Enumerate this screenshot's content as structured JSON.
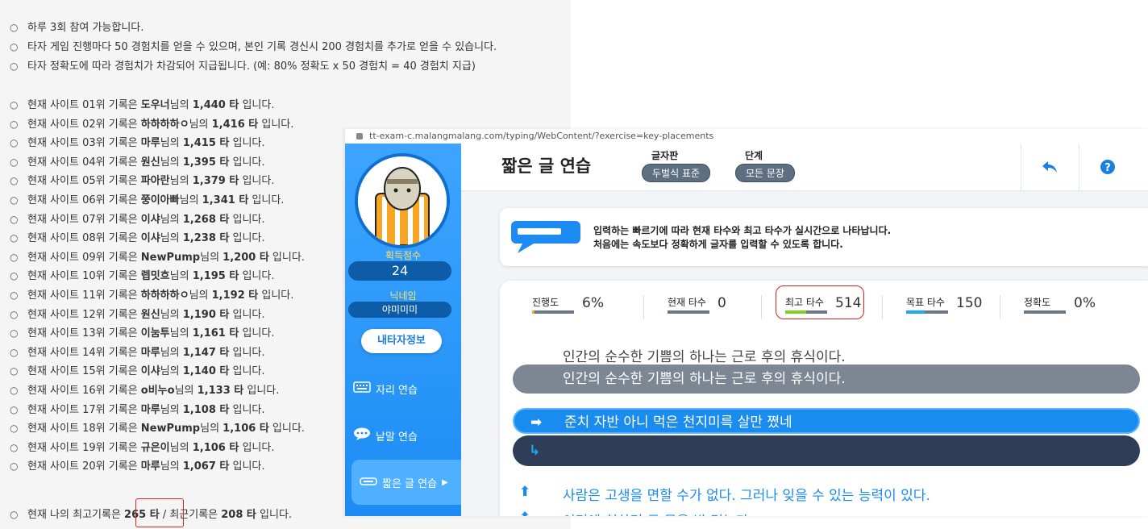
{
  "notices": {
    "rules": [
      "하루 3회 참여 가능합니다.",
      "타자 게임 진행마다 50 경험치를 얻을 수 있으며, 본인 기록 경신시 200 경험치를 추가로 얻을 수 있습니다.",
      "타자 정확도에 따라 경험치가 차감되어 지급됩니다. (예: 80% 정확도 x 50 경험치 = 40 경험치 지급)"
    ],
    "ranking_prefix": "현재 사이트",
    "ranking_mid": "기록은",
    "ranking_name_suffix": "님의",
    "ranking_suffix": "입니다.",
    "rankings": [
      {
        "rank": "01위",
        "name": "도우너",
        "score": "1,440 타"
      },
      {
        "rank": "02위",
        "name": "하하하하ㅇ",
        "score": "1,416 타"
      },
      {
        "rank": "03위",
        "name": "마루",
        "score": "1,415 타"
      },
      {
        "rank": "04위",
        "name": "원신",
        "score": "1,395 타"
      },
      {
        "rank": "05위",
        "name": "파아란",
        "score": "1,379 타"
      },
      {
        "rank": "06위",
        "name": "쭝이아빠",
        "score": "1,341 타"
      },
      {
        "rank": "07위",
        "name": "이샤",
        "score": "1,268 타"
      },
      {
        "rank": "08위",
        "name": "이샤",
        "score": "1,238 타"
      },
      {
        "rank": "09위",
        "name": "NewPump",
        "score": "1,200 타"
      },
      {
        "rank": "10위",
        "name": "렙밋흐",
        "score": "1,195 타"
      },
      {
        "rank": "11위",
        "name": "하하하하ㅇ",
        "score": "1,192 타"
      },
      {
        "rank": "12위",
        "name": "원신",
        "score": "1,190 타"
      },
      {
        "rank": "13위",
        "name": "이눔투",
        "score": "1,161 타"
      },
      {
        "rank": "14위",
        "name": "마루",
        "score": "1,147 타"
      },
      {
        "rank": "15위",
        "name": "이샤",
        "score": "1,140 타"
      },
      {
        "rank": "16위",
        "name": "o비누o",
        "score": "1,133 타"
      },
      {
        "rank": "17위",
        "name": "마루",
        "score": "1,108 타"
      },
      {
        "rank": "18위",
        "name": "NewPump",
        "score": "1,106 타"
      },
      {
        "rank": "19위",
        "name": "규은이",
        "score": "1,106 타"
      },
      {
        "rank": "20위",
        "name": "마루",
        "score": "1,067 타"
      }
    ],
    "my_record": {
      "prefix": "현재 나의 최고기록은",
      "best": "265 타",
      "mid": "/ 최근기록은",
      "recent": "208 타",
      "suffix": "입니다."
    }
  },
  "window": {
    "url": "tt-exam-c.malangmalang.com/typing/WebContent/?exercise=key-placements",
    "sidebar": {
      "score_label": "획득점수",
      "score_value": "24",
      "nickname_label": "닉네임",
      "nickname_value": "야미미미",
      "my_info_button": "내타자정보",
      "menu": [
        {
          "label": "자리 연습",
          "icon": "keyboard-icon"
        },
        {
          "label": "낱말 연습",
          "icon": "speech-bubble-icon"
        },
        {
          "label": "짧은 글 연습",
          "icon": "short-text-icon"
        }
      ]
    },
    "header": {
      "title": "짧은 글 연습",
      "keyboard_label": "글자판",
      "keyboard_value": "두벌식 표준",
      "level_label": "단계",
      "level_value": "모든 문장"
    },
    "info": {
      "line1": "입력하는 빠르기에 따라 현재 타수와 최고 타수가 실시간으로 나타납니다.",
      "line2": "처음에는 속도보다 정확하게 글자를 입력할 수 있도록 합니다."
    },
    "stats": [
      {
        "label": "진행도",
        "value": "6%",
        "fill": 0.06,
        "color": "#f5a623"
      },
      {
        "label": "현재 타수",
        "value": "0",
        "fill": 0,
        "color": "#7ed321"
      },
      {
        "label": "최고 타수",
        "value": "514",
        "fill": 0.5,
        "color": "#7ed321"
      },
      {
        "label": "목표 타수",
        "value": "150",
        "fill": 0.45,
        "color": "#1ea7ff"
      },
      {
        "label": "정확도",
        "value": "0%",
        "fill": 0,
        "color": "#1ea7ff"
      }
    ],
    "sentences": {
      "previous": "인간의 순수한 기쁨의 하나는 근로 후의 휴식이다.",
      "previous_typed": "인간의 순수한 기쁨의 하나는 근로 후의 휴식이다.",
      "current": "준치 자반 아니 먹은 천지미륵 살만 쪘네",
      "input": "",
      "next": "사람은 고생을 면할 수가 없다. 그러나 잊을 수 있는 능력이 있다.",
      "next2": "이리에 친하면 큰 물을 밤 먹는다"
    },
    "colors": {
      "sidebar": "#1c8cf4",
      "current_bar": "#1a8cf0",
      "input_bar": "#2d3e56",
      "highlight": "#e02020"
    }
  }
}
